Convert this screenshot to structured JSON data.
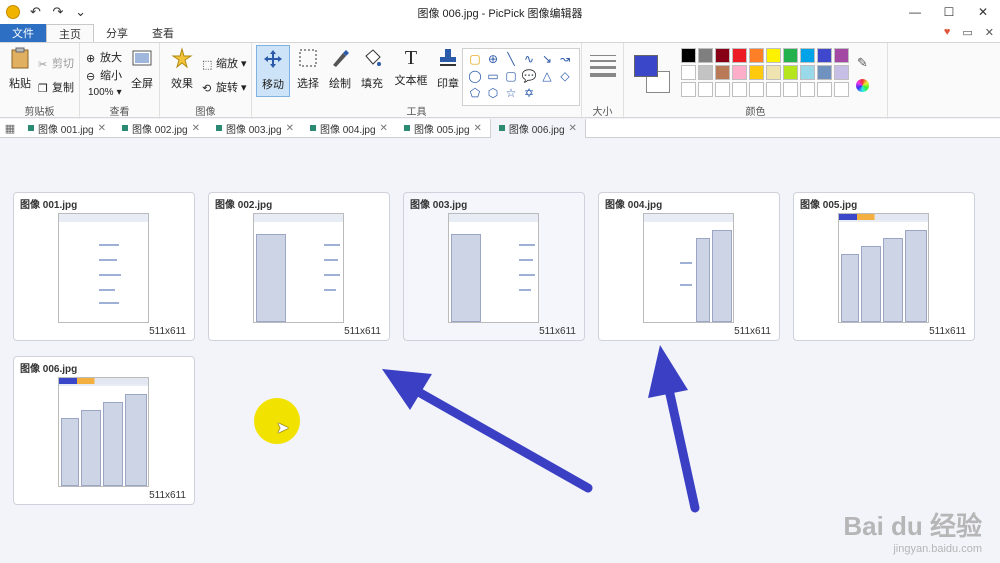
{
  "window": {
    "title": "图像 006.jpg - PicPick 图像编辑器",
    "qa_undo": "↶",
    "qa_redo": "↷",
    "qa_more": "⌄",
    "minimize": "—",
    "maximize": "☐",
    "close": "✕"
  },
  "ribbon_tabs": [
    "文件",
    "主页",
    "分享",
    "查看"
  ],
  "ribbon_right": {
    "heart": "♥",
    "restore": "▭",
    "close": "✕"
  },
  "ribbon": {
    "clipboard": {
      "paste": "粘贴",
      "cut": "剪切",
      "copy": "复制",
      "label": "剪贴板"
    },
    "view": {
      "zoom_in": "放大",
      "zoom_out": "缩小",
      "zoom_level": "100%",
      "fullscreen": "全屏",
      "label": "查看"
    },
    "image": {
      "effects": "效果",
      "resize": "缩放",
      "rotate": "旋转",
      "label": "图像"
    },
    "tools": {
      "move": "移动",
      "select": "选择",
      "draw": "绘制",
      "fill": "填充",
      "textbox": "文本框",
      "stamp": "印章",
      "label": "工具"
    },
    "size": {
      "label": "大小"
    },
    "colors": {
      "label": "颜色",
      "current": "#3a47c9",
      "palette": [
        "#000000",
        "#7f7f7f",
        "#880015",
        "#ed1c24",
        "#ff7f27",
        "#fff200",
        "#22b14c",
        "#00a2e8",
        "#3f48cc",
        "#a349a4",
        "#ffffff",
        "#c3c3c3",
        "#b97a57",
        "#ffaec9",
        "#ffc90e",
        "#efe4b0",
        "#b5e61d",
        "#99d9ea",
        "#7092be",
        "#c8bfe7",
        "#ffffff",
        "#ffffff",
        "#ffffff",
        "#ffffff",
        "#ffffff",
        "#ffffff",
        "#ffffff",
        "#ffffff",
        "#ffffff",
        "#ffffff"
      ]
    }
  },
  "doc_tabs": [
    {
      "label": "图像 001.jpg",
      "active": false
    },
    {
      "label": "图像 002.jpg",
      "active": false
    },
    {
      "label": "图像 003.jpg",
      "active": false
    },
    {
      "label": "图像 004.jpg",
      "active": false
    },
    {
      "label": "图像 005.jpg",
      "active": false
    },
    {
      "label": "图像 006.jpg",
      "active": true
    }
  ],
  "thumbnails": [
    {
      "title": "图像 001.jpg",
      "size": "511x611"
    },
    {
      "title": "图像 002.jpg",
      "size": "511x611"
    },
    {
      "title": "图像 003.jpg",
      "size": "511x611"
    },
    {
      "title": "图像 004.jpg",
      "size": "511x611"
    },
    {
      "title": "图像 005.jpg",
      "size": "511x611"
    },
    {
      "title": "图像 006.jpg",
      "size": "511x611"
    }
  ],
  "watermark": {
    "brand": "Bai du 经验",
    "url": "jingyan.baidu.com"
  },
  "annotation_color": "#3a3fc4"
}
